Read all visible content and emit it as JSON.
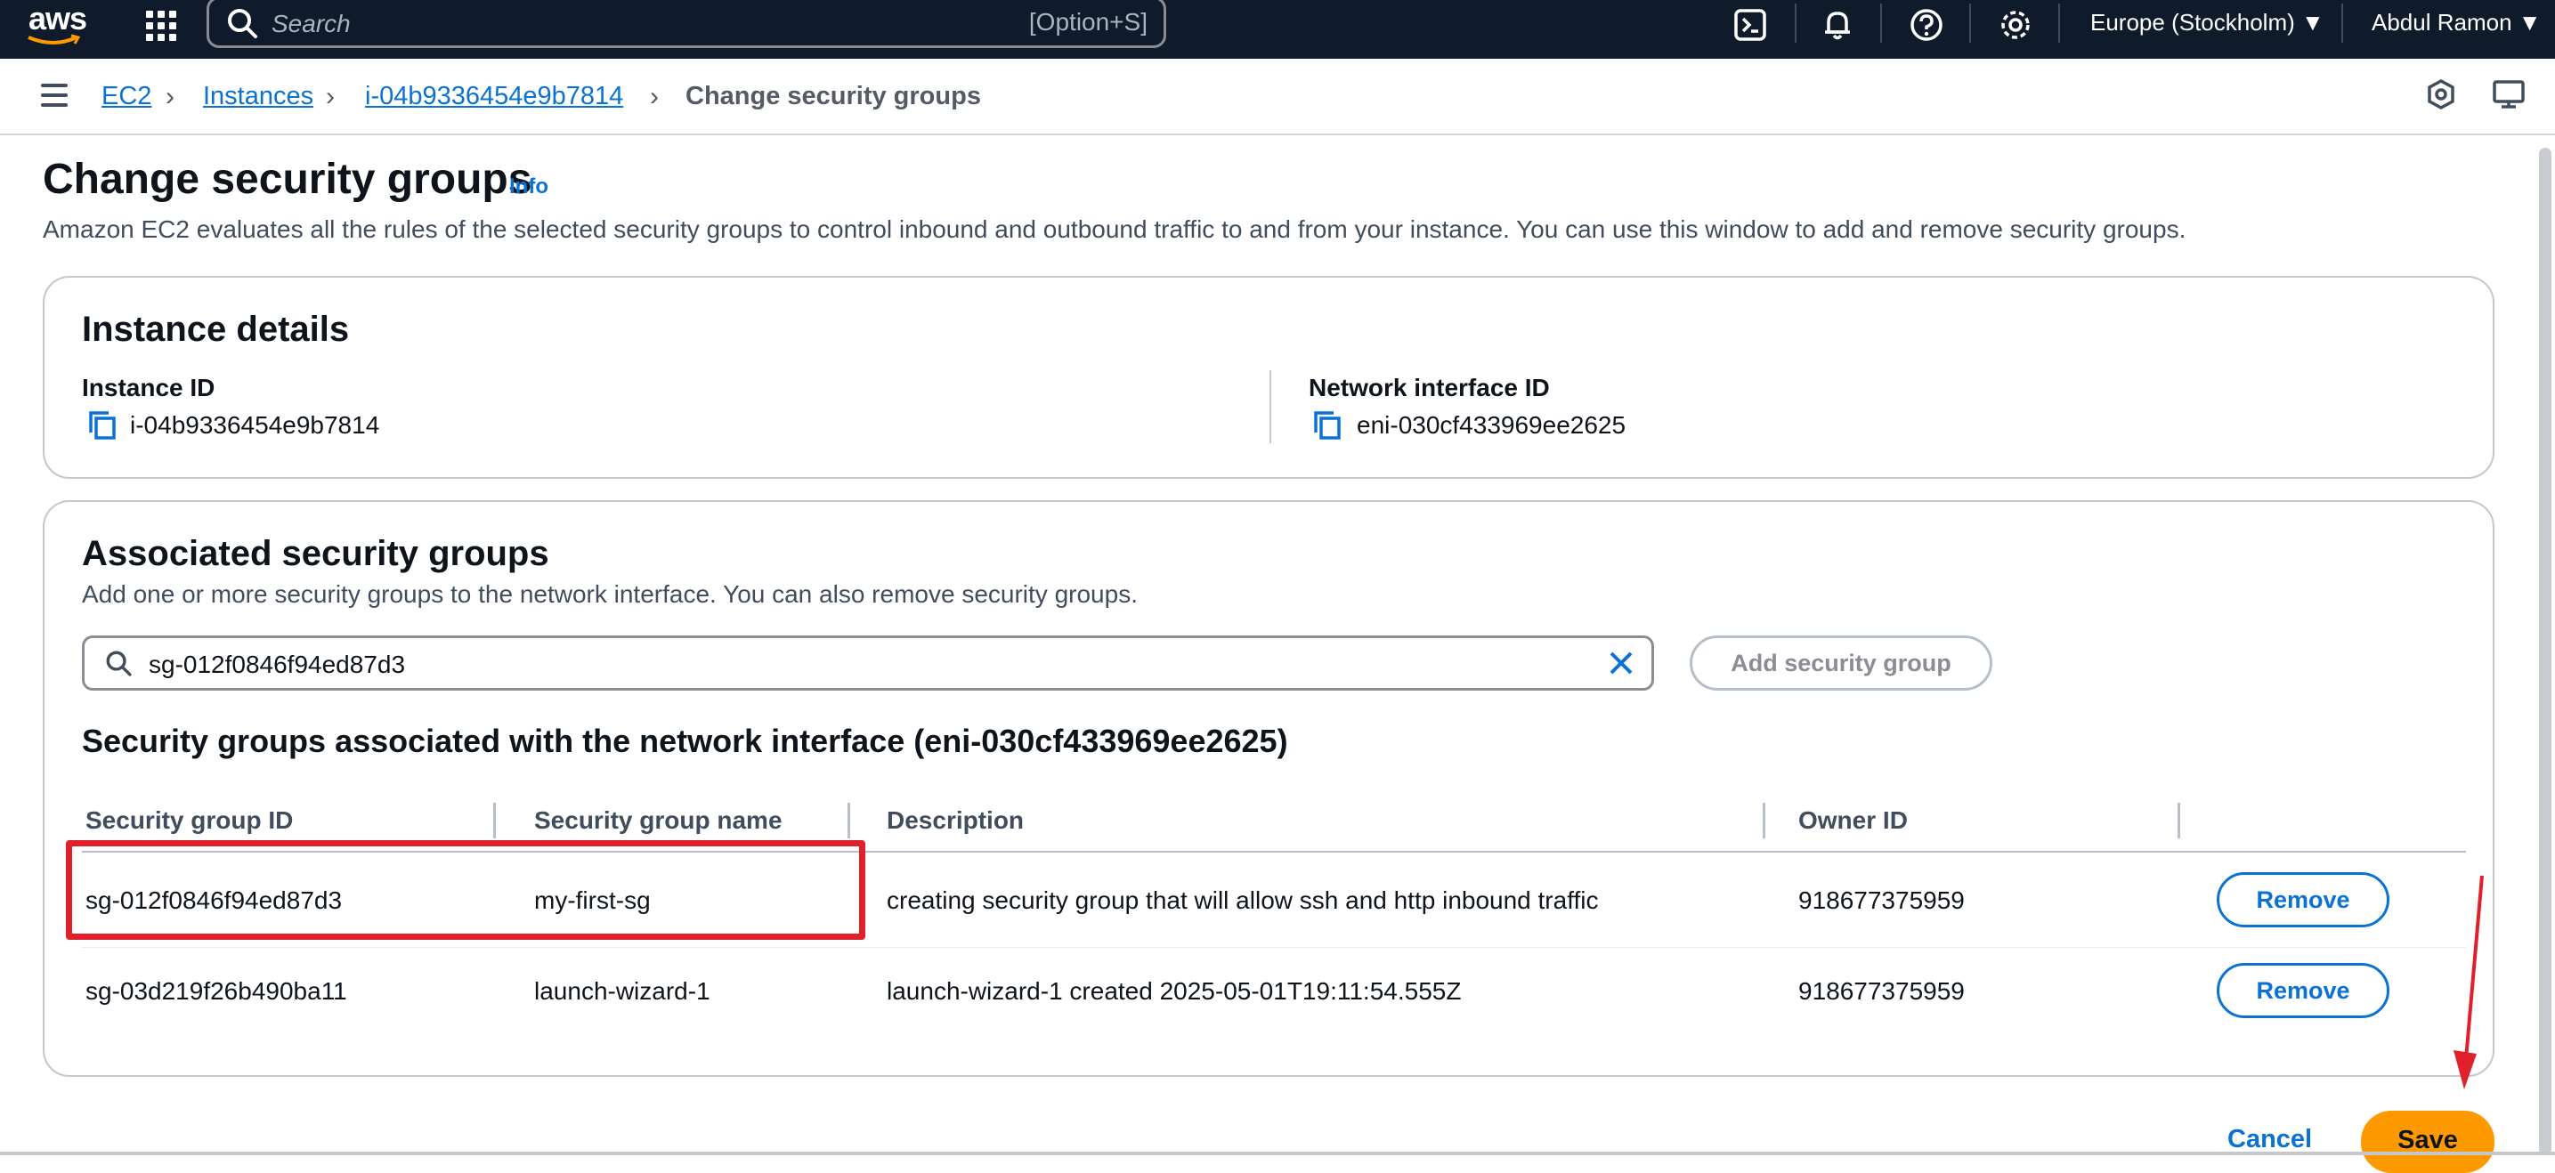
{
  "topnav": {
    "logo": "aws",
    "search_placeholder": "Search",
    "search_shortcut": "[Option+S]",
    "region": "Europe (Stockholm)",
    "user": "Abdul Ramon",
    "icons": [
      "grid-menu-icon",
      "search-icon",
      "cloudshell-icon",
      "bell-icon",
      "help-icon",
      "gear-icon"
    ]
  },
  "breadcrumb": {
    "items": [
      "EC2",
      "Instances",
      "i-04b9336454e9b7814"
    ],
    "current": "Change security groups"
  },
  "page": {
    "title": "Change security groups",
    "info": "Info",
    "description": "Amazon EC2 evaluates all the rules of the selected security groups to control inbound and outbound traffic to and from your instance. You can use this window to add and remove security groups."
  },
  "instance_details": {
    "title": "Instance details",
    "instance_id_label": "Instance ID",
    "instance_id": "i-04b9336454e9b7814",
    "eni_label": "Network interface ID",
    "eni_id": "eni-030cf433969ee2625"
  },
  "associated": {
    "title": "Associated security groups",
    "description": "Add one or more security groups to the network interface. You can also remove security groups.",
    "search_value": "sg-012f0846f94ed87d3",
    "add_button": "Add security group",
    "table_title": "Security groups associated with the network interface (eni-030cf433969ee2625)",
    "columns": [
      "Security group ID",
      "Security group name",
      "Description",
      "Owner ID"
    ],
    "rows": [
      {
        "id": "sg-012f0846f94ed87d3",
        "name": "my-first-sg",
        "description": "creating security group that will allow ssh and http inbound traffic",
        "owner": "918677375959",
        "action": "Remove"
      },
      {
        "id": "sg-03d219f26b490ba11",
        "name": "launch-wizard-1",
        "description": "launch-wizard-1 created 2025-05-01T19:11:54.555Z",
        "owner": "918677375959",
        "action": "Remove"
      }
    ]
  },
  "footer": {
    "cancel": "Cancel",
    "save": "Save"
  },
  "colors": {
    "nav_bg": "#0f1b2a",
    "link": "#0972d3",
    "primary_button": "#ff9900",
    "annotation": "#e0202a"
  }
}
